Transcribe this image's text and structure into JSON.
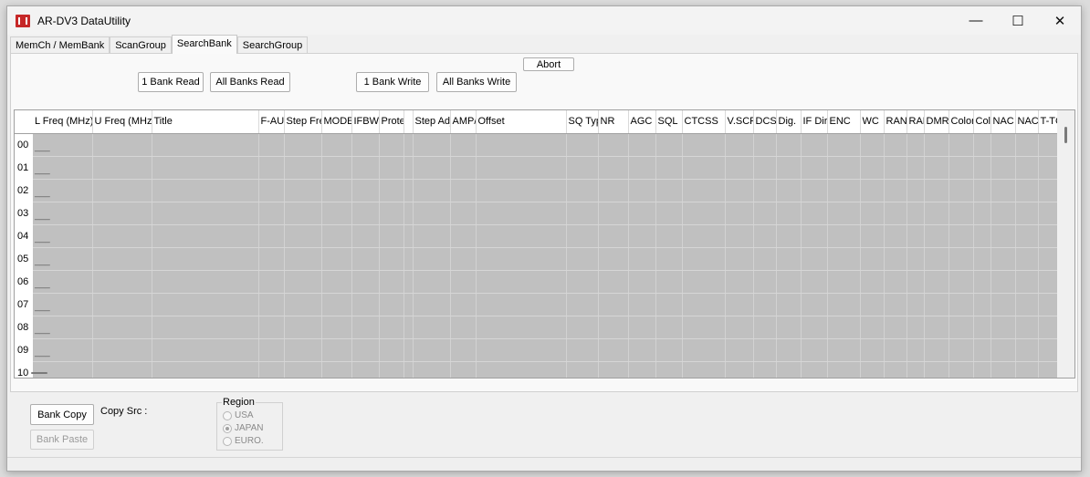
{
  "window": {
    "title": "AR-DV3 DataUtility",
    "controls": {
      "minimize": "—",
      "maximize": "☐",
      "close": "✕"
    }
  },
  "tabs": [
    {
      "label": "MemCh / MemBank",
      "active": false
    },
    {
      "label": "ScanGroup",
      "active": false
    },
    {
      "label": "SearchBank",
      "active": true
    },
    {
      "label": "SearchGroup",
      "active": false
    }
  ],
  "toolbar": {
    "bank_read": "1 Bank Read",
    "all_banks_read": "All Banks Read",
    "bank_write": "1 Bank Write",
    "all_banks_write": "All Banks Write",
    "abort": "Abort"
  },
  "grid": {
    "columns": [
      "L Freq (MHz)",
      "U Freq (MHz)",
      "Title",
      "F-AUTO",
      "Step Freq",
      "MODE",
      "IFBW",
      "Protect",
      "",
      "Step Adj",
      "AMP/",
      "Offset",
      "SQ Type",
      "NR",
      "AGC",
      "SQL",
      "CTCSS",
      "V.SCR",
      "DCS",
      "Dig.",
      "IF Dir",
      "ENC",
      "WC",
      "RAN",
      "RAN",
      "DMR",
      "Color",
      "Color",
      "NAC",
      "NAC",
      "T-TC"
    ],
    "rows": [
      "00",
      "01",
      "02",
      "03",
      "04",
      "05",
      "06",
      "07",
      "08",
      "09",
      "10"
    ],
    "placeholder": "___"
  },
  "bottom": {
    "bank_copy": "Bank Copy",
    "bank_paste": "Bank Paste",
    "copy_src_label": "Copy Src :",
    "region": {
      "legend": "Region",
      "options": [
        {
          "label": "USA",
          "checked": false
        },
        {
          "label": "JAPAN",
          "checked": true
        },
        {
          "label": "EURO.",
          "checked": false
        }
      ]
    }
  }
}
